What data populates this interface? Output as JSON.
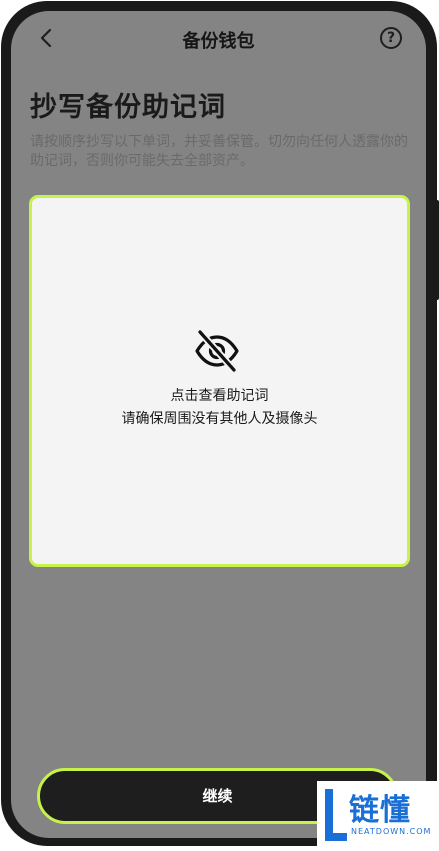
{
  "header": {
    "title": "备份钱包",
    "help_symbol": "?",
    "back_icon": "chevron-left-icon",
    "help_icon": "question-circle-icon"
  },
  "main": {
    "title": "抄写备份助记词",
    "instructions": "请按顺序抄写以下单词，并妥善保管。切勿向任何人透露你的助记词，否则你可能失去全部资产。",
    "card": {
      "icon": "eye-off-icon",
      "line1": "点击查看助记词",
      "line2": "请确保周围没有其他人及摄像头"
    }
  },
  "footer": {
    "continue_label": "继续"
  },
  "watermark": {
    "brand": "链懂",
    "domain": "NEATDOWN.COM"
  },
  "colors": {
    "accent": "#c6f24a",
    "screen_bg": "#848484",
    "button_bg": "#1e1e1e",
    "watermark": "#1a6fd6"
  }
}
